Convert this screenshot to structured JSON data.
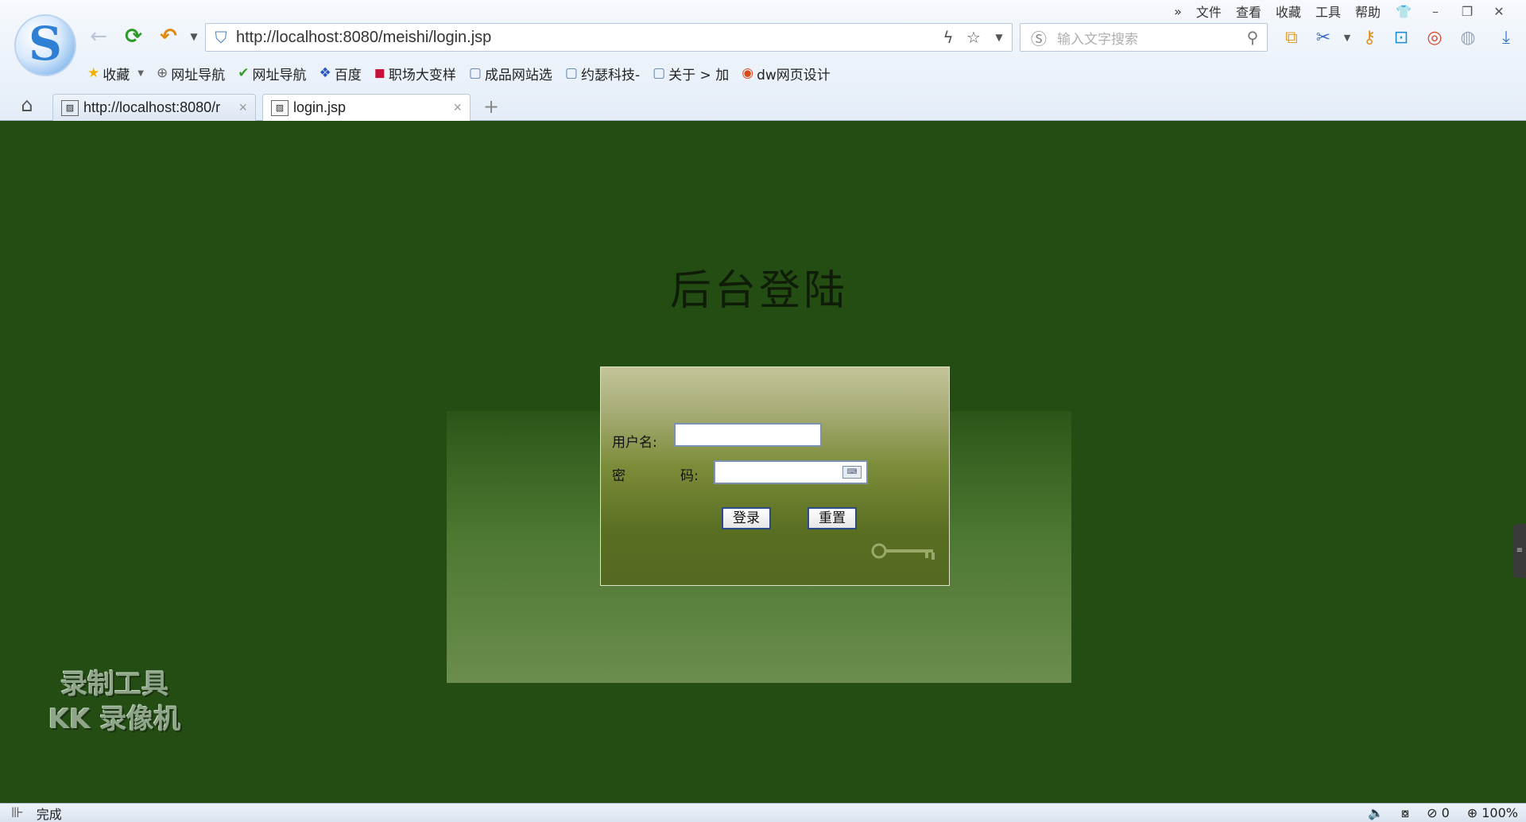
{
  "menu": [
    "文件",
    "查看",
    "收藏",
    "工具",
    "帮助"
  ],
  "menu_more": "»",
  "window_controls": {
    "skin": "👕",
    "minimize": "–",
    "restore": "❐",
    "close": "✕"
  },
  "nav": {
    "back": "←",
    "reload": "⟳",
    "undo": "↶"
  },
  "address": {
    "url": "http://localhost:8080/meishi/login.jsp"
  },
  "search": {
    "placeholder": "输入文字搜索"
  },
  "bookmarks": [
    {
      "label": "收藏",
      "icon": "star-icon",
      "glyph": "★"
    },
    {
      "label": "网址导航",
      "icon": "globe-icon",
      "glyph": "⊕"
    },
    {
      "label": "网址导航",
      "icon": "hao-icon",
      "glyph": "✔"
    },
    {
      "label": "百度",
      "icon": "baidu-icon",
      "glyph": "❖"
    },
    {
      "label": "职场大变样",
      "icon": "red-icon",
      "glyph": "◼"
    },
    {
      "label": "成品网站选",
      "icon": "page-icon",
      "glyph": "▢"
    },
    {
      "label": "约瑟科技-",
      "icon": "page-icon",
      "glyph": "▢"
    },
    {
      "label": "关于 > 加",
      "icon": "page-icon",
      "glyph": "▢"
    },
    {
      "label": "dw网页设计",
      "icon": "eye-icon",
      "glyph": "◉"
    }
  ],
  "tabs": [
    {
      "title": "http://localhost:8080/r",
      "close": "×"
    },
    {
      "title": "login.jsp",
      "close": "×"
    }
  ],
  "new_tab": "+",
  "page": {
    "title": "后台登陆",
    "username_label": "用户名:",
    "password_label_1": "密",
    "password_label_2": "码:",
    "login_button": "登录",
    "reset_button": "重置",
    "username_value": "",
    "password_value": ""
  },
  "watermark": {
    "line1": "录制工具",
    "line2": "KK 录像机"
  },
  "status": {
    "text": "完成",
    "blocked_count": "0",
    "zoom": "100%"
  },
  "colors": {
    "page_bg": "#234d13",
    "box_top": "#c3c599",
    "box_bottom": "#546822"
  }
}
